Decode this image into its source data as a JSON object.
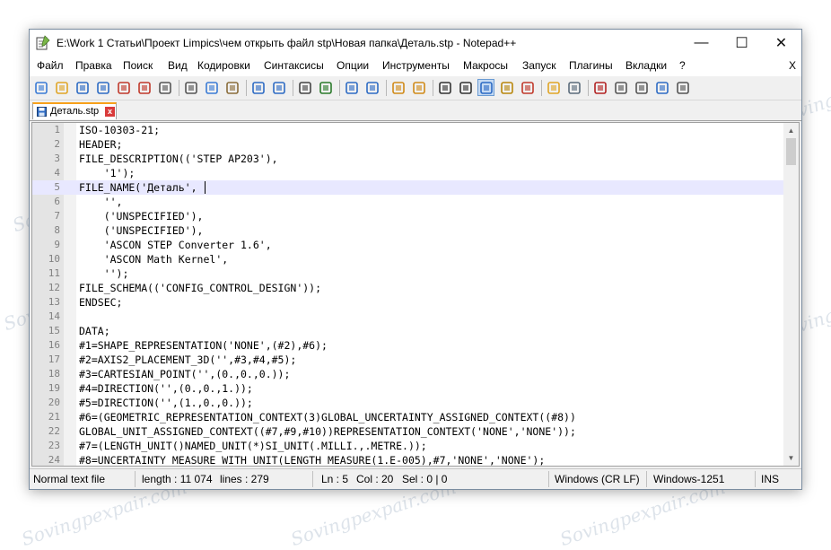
{
  "watermark": "Sovingpexpair.com",
  "window": {
    "title": "E:\\Work 1 Статьи\\Проект Limpics\\чем открыть файл stp\\Новая папка\\Деталь.stp - Notepad++",
    "minimize": "—",
    "maximize": "☐",
    "close": "✕"
  },
  "menu": {
    "items": [
      "Файл",
      "Правка",
      "Поиск",
      "Вид",
      "Кодировки",
      "Синтаксисы",
      "Опции",
      "Инструменты",
      "Макросы",
      "Запуск",
      "Плагины",
      "Вкладки",
      "?"
    ],
    "close": "X"
  },
  "toolbar": {
    "icons": [
      "new-file-icon",
      "open-file-icon",
      "save-icon",
      "save-all-icon",
      "close-icon",
      "close-all-icon",
      "print-icon",
      "cut-icon",
      "copy-icon",
      "paste-icon",
      "undo-icon",
      "redo-icon",
      "find-icon",
      "replace-icon",
      "zoom-in-icon",
      "zoom-out-icon",
      "sync-vertical-icon",
      "sync-horizontal-icon",
      "word-wrap-icon",
      "all-chars-icon",
      "indent-guide-icon",
      "language-icon",
      "function-list-icon",
      "folder-icon",
      "monitor-icon",
      "record-macro-icon",
      "stop-macro-icon",
      "play-macro-icon",
      "run-macro-multiple-icon",
      "save-macro-icon"
    ]
  },
  "tab": {
    "label": "Деталь.stp",
    "close": "x"
  },
  "editor": {
    "current_line": 5,
    "lines": [
      "ISO-10303-21;",
      "HEADER;",
      "FILE_DESCRIPTION(('STEP AP203'),",
      "    '1');",
      "FILE_NAME('Деталь',",
      "    '',",
      "    ('UNSPECIFIED'),",
      "    ('UNSPECIFIED'),",
      "    'ASCON STEP Converter 1.6',",
      "    'ASCON Math Kernel',",
      "    '');",
      "FILE_SCHEMA(('CONFIG_CONTROL_DESIGN'));",
      "ENDSEC;",
      "",
      "DATA;",
      "#1=SHAPE_REPRESENTATION('NONE',(#2),#6);",
      "#2=AXIS2_PLACEMENT_3D('',#3,#4,#5);",
      "#3=CARTESIAN_POINT('',(0.,0.,0.));",
      "#4=DIRECTION('',(0.,0.,1.));",
      "#5=DIRECTION('',(1.,0.,0.));",
      "#6=(GEOMETRIC_REPRESENTATION_CONTEXT(3)GLOBAL_UNCERTAINTY_ASSIGNED_CONTEXT((#8))",
      "GLOBAL_UNIT_ASSIGNED_CONTEXT((#7,#9,#10))REPRESENTATION_CONTEXT('NONE','NONE'));",
      "#7=(LENGTH_UNIT()NAMED_UNIT(*)SI_UNIT(.MILLI.,.METRE.));",
      "#8=UNCERTAINTY_MEASURE_WITH_UNIT(LENGTH_MEASURE(1.E-005),#7,'NONE','NONE');"
    ]
  },
  "status": {
    "type": "Normal text file",
    "length": "length : 11 074",
    "lines": "lines : 279",
    "ln": "Ln : 5",
    "col": "Col : 20",
    "sel": "Sel : 0 | 0",
    "eol": "Windows (CR LF)",
    "encoding": "Windows-1251",
    "mode": "INS"
  }
}
